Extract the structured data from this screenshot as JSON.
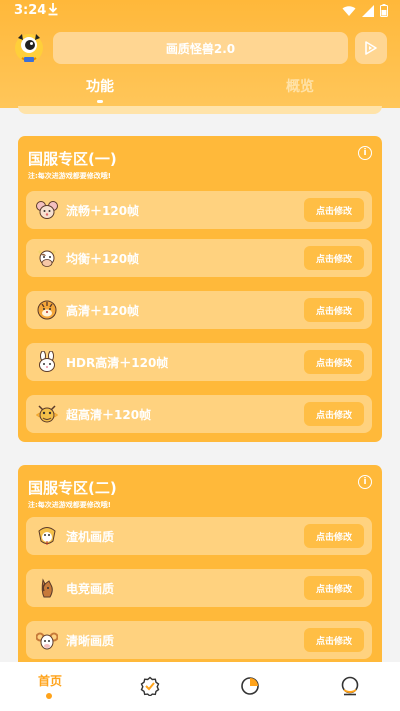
{
  "status_bar": {
    "time": "3:24"
  },
  "header": {
    "title": "画质怪兽2.0",
    "tabs": [
      {
        "label": "功能",
        "active": true
      },
      {
        "label": "概览",
        "active": false
      }
    ]
  },
  "sections": [
    {
      "title": "国服专区(一)",
      "note": "注:每次进游戏都要修改哦!",
      "rows": [
        {
          "icon": "mouse-icon",
          "label": "流畅＋120帧",
          "button": "点击修改"
        },
        {
          "icon": "cow-icon",
          "label": "均衡＋120帧",
          "button": "点击修改"
        },
        {
          "icon": "tiger-icon",
          "label": "高清＋120帧",
          "button": "点击修改"
        },
        {
          "icon": "rabbit-icon",
          "label": "HDR高清＋120帧",
          "button": "点击修改"
        },
        {
          "icon": "dragon-icon",
          "label": "超高清＋120帧",
          "button": "点击修改"
        }
      ]
    },
    {
      "title": "国服专区(二)",
      "note": "注:每次进游戏都要修改哦!",
      "rows": [
        {
          "icon": "snake-icon",
          "label": "渣机画质",
          "button": "点击修改"
        },
        {
          "icon": "horse-icon",
          "label": "电竞画质",
          "button": "点击修改"
        },
        {
          "icon": "goat-icon",
          "label": "清晰画质",
          "button": "点击修改"
        }
      ]
    }
  ],
  "bottom_nav": {
    "home_label": "首页",
    "items": [
      "home",
      "badge-check-icon",
      "pie-chart-icon",
      "profile-icon"
    ]
  },
  "colors": {
    "accent": "#ffb93a",
    "row_bg": "#ffd27f",
    "button_bg": "#ffbe45",
    "nav_active": "#ffa31a"
  }
}
